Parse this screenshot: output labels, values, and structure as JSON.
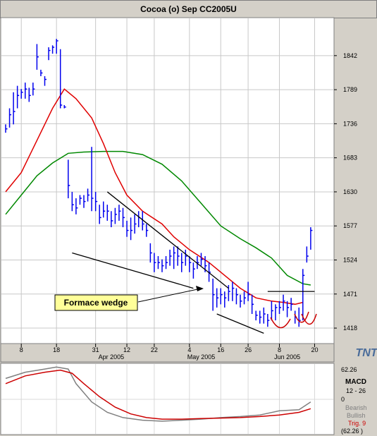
{
  "window": {
    "title": "Cocoa (o) Sep CC2005U"
  },
  "colors": {
    "bars": "#0000ee",
    "ma_fast": "#e00000",
    "ma_slow": "#008800",
    "trendline": "#000000",
    "macd_line": "#808080",
    "signal_line": "#cc0000",
    "annotation_bg": "#ffff99",
    "panel_bg": "#ffffff",
    "frame_bg": "#d4d0c8"
  },
  "logo": {
    "text": "TNT"
  },
  "annotation": {
    "label": "Formace wedge"
  },
  "main_panel": {
    "y_ticks": [
      "1842",
      "1789",
      "1736",
      "1683",
      "1630",
      "1577",
      "1524",
      "1471",
      "1418"
    ],
    "x_ticks": [
      "8",
      "18",
      "31",
      "12",
      "22",
      "4",
      "16",
      "26",
      "8",
      "20"
    ],
    "month_labels": [
      "Apr 2005",
      "May 2005",
      "Jun 2005"
    ]
  },
  "macd_panel": {
    "name": "MACD",
    "params": "12 - 26",
    "tick_top": "62.26",
    "tick_zero": "0",
    "tick_bottom": "(62.26 )",
    "bearish_label": "Bearish",
    "bullish_label": "Bullish",
    "trig_label": "Trig. 9"
  },
  "chart_data": [
    {
      "type": "ohlc",
      "title": "Cocoa (o) Sep CC2005U",
      "ylim": [
        1395,
        1900
      ],
      "y_ticks": [
        1418,
        1471,
        1524,
        1577,
        1630,
        1683,
        1736,
        1789,
        1842
      ],
      "bars": [
        [
          1735,
          1722,
          1728
        ],
        [
          1760,
          1730,
          1750
        ],
        [
          1785,
          1735,
          1755
        ],
        [
          1795,
          1760,
          1780
        ],
        [
          1790,
          1775,
          1785
        ],
        [
          1800,
          1775,
          1790
        ],
        [
          1792,
          1770,
          1780
        ],
        [
          1800,
          1780,
          1790
        ],
        [
          1860,
          1820,
          1840
        ],
        [
          1820,
          1810,
          1815
        ],
        [
          1810,
          1795,
          1805
        ],
        [
          1855,
          1835,
          1850
        ],
        [
          1858,
          1845,
          1855
        ],
        [
          1868,
          1845,
          1865
        ],
        [
          1852,
          1760,
          1765
        ],
        [
          1765,
          1760,
          1762
        ],
        [
          1680,
          1620,
          1640
        ],
        [
          1630,
          1600,
          1610
        ],
        [
          1620,
          1595,
          1605
        ],
        [
          1625,
          1610,
          1620
        ],
        [
          1625,
          1605,
          1615
        ],
        [
          1635,
          1615,
          1625
        ],
        [
          1700,
          1600,
          1620
        ],
        [
          1630,
          1600,
          1615
        ],
        [
          1610,
          1580,
          1590
        ],
        [
          1615,
          1590,
          1600
        ],
        [
          1610,
          1585,
          1600
        ],
        [
          1600,
          1575,
          1585
        ],
        [
          1605,
          1580,
          1595
        ],
        [
          1610,
          1585,
          1600
        ],
        [
          1605,
          1575,
          1590
        ],
        [
          1585,
          1560,
          1570
        ],
        [
          1590,
          1555,
          1570
        ],
        [
          1595,
          1565,
          1580
        ],
        [
          1600,
          1575,
          1590
        ],
        [
          1600,
          1570,
          1580
        ],
        [
          1580,
          1560,
          1570
        ],
        [
          1550,
          1520,
          1535
        ],
        [
          1535,
          1505,
          1520
        ],
        [
          1530,
          1510,
          1520
        ],
        [
          1525,
          1505,
          1515
        ],
        [
          1530,
          1510,
          1520
        ],
        [
          1540,
          1515,
          1530
        ],
        [
          1545,
          1510,
          1535
        ],
        [
          1545,
          1515,
          1530
        ],
        [
          1535,
          1505,
          1520
        ],
        [
          1540,
          1515,
          1530
        ],
        [
          1530,
          1505,
          1520
        ],
        [
          1520,
          1495,
          1510
        ],
        [
          1530,
          1510,
          1520
        ],
        [
          1535,
          1515,
          1525
        ],
        [
          1530,
          1505,
          1515
        ],
        [
          1520,
          1490,
          1505
        ],
        [
          1495,
          1445,
          1470
        ],
        [
          1480,
          1450,
          1465
        ],
        [
          1480,
          1455,
          1470
        ],
        [
          1475,
          1450,
          1465
        ],
        [
          1485,
          1460,
          1475
        ],
        [
          1490,
          1460,
          1480
        ],
        [
          1480,
          1455,
          1470
        ],
        [
          1470,
          1450,
          1460
        ],
        [
          1475,
          1455,
          1465
        ],
        [
          1490,
          1460,
          1470
        ],
        [
          1470,
          1440,
          1455
        ],
        [
          1445,
          1430,
          1438
        ],
        [
          1445,
          1425,
          1435
        ],
        [
          1450,
          1425,
          1440
        ],
        [
          1440,
          1420,
          1430
        ],
        [
          1460,
          1430,
          1445
        ],
        [
          1455,
          1430,
          1450
        ],
        [
          1460,
          1440,
          1450
        ],
        [
          1470,
          1445,
          1460
        ],
        [
          1460,
          1435,
          1450
        ],
        [
          1465,
          1445,
          1455
        ],
        [
          1445,
          1425,
          1435
        ],
        [
          1450,
          1420,
          1430
        ],
        [
          1510,
          1430,
          1500
        ],
        [
          1545,
          1520,
          1530
        ],
        [
          1575,
          1540,
          1570
        ]
      ],
      "ma_fast": [
        [
          0,
          1630
        ],
        [
          4,
          1660
        ],
        [
          8,
          1710
        ],
        [
          12,
          1760
        ],
        [
          15,
          1790
        ],
        [
          18,
          1775
        ],
        [
          22,
          1745
        ],
        [
          25,
          1705
        ],
        [
          28,
          1660
        ],
        [
          31,
          1625
        ],
        [
          35,
          1600
        ],
        [
          40,
          1580
        ],
        [
          43,
          1560
        ],
        [
          47,
          1540
        ],
        [
          52,
          1520
        ],
        [
          55,
          1505
        ],
        [
          60,
          1480
        ],
        [
          64,
          1465
        ],
        [
          68,
          1460
        ],
        [
          71,
          1458
        ],
        [
          74,
          1455
        ],
        [
          76,
          1458
        ]
      ],
      "ma_slow": [
        [
          0,
          1595
        ],
        [
          4,
          1625
        ],
        [
          8,
          1655
        ],
        [
          12,
          1675
        ],
        [
          16,
          1690
        ],
        [
          20,
          1692
        ],
        [
          25,
          1693
        ],
        [
          30,
          1693
        ],
        [
          35,
          1688
        ],
        [
          40,
          1673
        ],
        [
          45,
          1647
        ],
        [
          50,
          1612
        ],
        [
          55,
          1577
        ],
        [
          60,
          1557
        ],
        [
          64,
          1543
        ],
        [
          68,
          1527
        ],
        [
          72,
          1500
        ],
        [
          76,
          1487
        ],
        [
          78,
          1485
        ]
      ],
      "trendlines": [
        [
          [
            26,
            1630
          ],
          [
            57,
            1480
          ]
        ],
        [
          [
            17,
            1535
          ],
          [
            48,
            1480
          ]
        ],
        [
          [
            54,
            1440
          ],
          [
            66,
            1410
          ]
        ],
        [
          [
            67,
            1475
          ],
          [
            79,
            1475
          ]
        ]
      ]
    },
    {
      "type": "line",
      "name": "MACD",
      "ylim": [
        -62.26,
        62.26
      ],
      "macd": [
        [
          0,
          40
        ],
        [
          5,
          52
        ],
        [
          10,
          58
        ],
        [
          13,
          62
        ],
        [
          16,
          58
        ],
        [
          18,
          30
        ],
        [
          22,
          -5
        ],
        [
          26,
          -25
        ],
        [
          30,
          -35
        ],
        [
          35,
          -40
        ],
        [
          40,
          -42
        ],
        [
          45,
          -40
        ],
        [
          50,
          -38
        ],
        [
          55,
          -35
        ],
        [
          60,
          -33
        ],
        [
          65,
          -30
        ],
        [
          70,
          -22
        ],
        [
          75,
          -20
        ],
        [
          78,
          -5
        ]
      ],
      "signal": [
        [
          0,
          30
        ],
        [
          5,
          45
        ],
        [
          10,
          52
        ],
        [
          14,
          56
        ],
        [
          17,
          50
        ],
        [
          20,
          30
        ],
        [
          24,
          5
        ],
        [
          28,
          -15
        ],
        [
          32,
          -28
        ],
        [
          36,
          -35
        ],
        [
          40,
          -38
        ],
        [
          45,
          -38
        ],
        [
          50,
          -37
        ],
        [
          55,
          -36
        ],
        [
          60,
          -35
        ],
        [
          65,
          -33
        ],
        [
          70,
          -30
        ],
        [
          75,
          -25
        ],
        [
          78,
          -18
        ]
      ]
    }
  ]
}
